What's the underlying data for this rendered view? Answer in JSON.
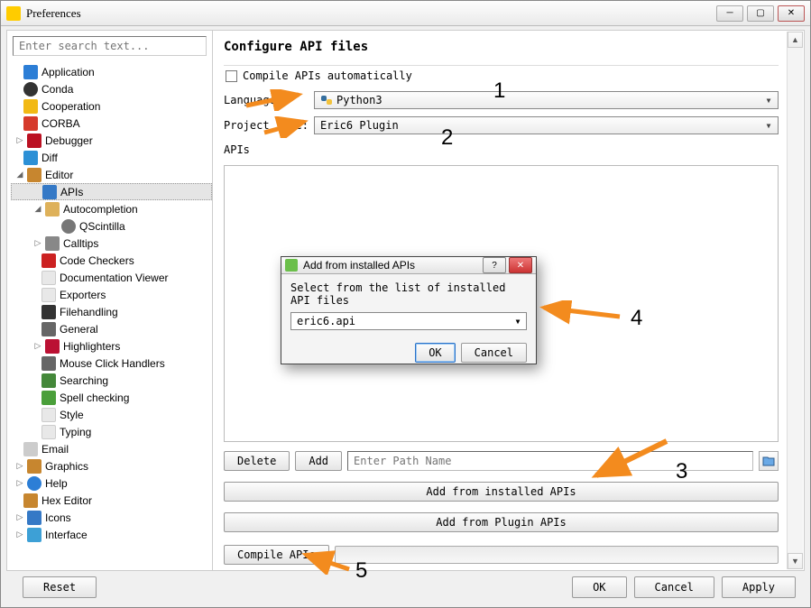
{
  "window": {
    "title": "Preferences"
  },
  "search": {
    "placeholder": "Enter search text..."
  },
  "tree": [
    {
      "label": "Application",
      "depth": 0,
      "hasChildren": false,
      "icon": "ic-app"
    },
    {
      "label": "Conda",
      "depth": 0,
      "hasChildren": false,
      "icon": "ic-conda"
    },
    {
      "label": "Cooperation",
      "depth": 0,
      "hasChildren": false,
      "icon": "ic-coop"
    },
    {
      "label": "CORBA",
      "depth": 0,
      "hasChildren": false,
      "icon": "ic-corba"
    },
    {
      "label": "Debugger",
      "depth": 0,
      "hasChildren": true,
      "expanded": false,
      "icon": "ic-debug"
    },
    {
      "label": "Diff",
      "depth": 0,
      "hasChildren": false,
      "icon": "ic-diff"
    },
    {
      "label": "Editor",
      "depth": 0,
      "hasChildren": true,
      "expanded": true,
      "icon": "ic-editor"
    },
    {
      "label": "APIs",
      "depth": 1,
      "hasChildren": false,
      "icon": "ic-apis",
      "selected": true
    },
    {
      "label": "Autocompletion",
      "depth": 1,
      "hasChildren": true,
      "expanded": true,
      "icon": "ic-auto"
    },
    {
      "label": "QScintilla",
      "depth": 2,
      "hasChildren": false,
      "icon": "ic-qs"
    },
    {
      "label": "Calltips",
      "depth": 1,
      "hasChildren": true,
      "expanded": false,
      "icon": "ic-call"
    },
    {
      "label": "Code Checkers",
      "depth": 1,
      "hasChildren": false,
      "icon": "ic-code"
    },
    {
      "label": "Documentation Viewer",
      "depth": 1,
      "hasChildren": false,
      "icon": "ic-doc"
    },
    {
      "label": "Exporters",
      "depth": 1,
      "hasChildren": false,
      "icon": "ic-exp"
    },
    {
      "label": "Filehandling",
      "depth": 1,
      "hasChildren": false,
      "icon": "ic-file"
    },
    {
      "label": "General",
      "depth": 1,
      "hasChildren": false,
      "icon": "ic-gen"
    },
    {
      "label": "Highlighters",
      "depth": 1,
      "hasChildren": true,
      "expanded": false,
      "icon": "ic-hl"
    },
    {
      "label": "Mouse Click Handlers",
      "depth": 1,
      "hasChildren": false,
      "icon": "ic-mouse"
    },
    {
      "label": "Searching",
      "depth": 1,
      "hasChildren": false,
      "icon": "ic-search"
    },
    {
      "label": "Spell checking",
      "depth": 1,
      "hasChildren": false,
      "icon": "ic-spell"
    },
    {
      "label": "Style",
      "depth": 1,
      "hasChildren": false,
      "icon": "ic-style"
    },
    {
      "label": "Typing",
      "depth": 1,
      "hasChildren": false,
      "icon": "ic-type"
    },
    {
      "label": "Email",
      "depth": 0,
      "hasChildren": false,
      "icon": "ic-email"
    },
    {
      "label": "Graphics",
      "depth": 0,
      "hasChildren": true,
      "expanded": false,
      "icon": "ic-gfx"
    },
    {
      "label": "Help",
      "depth": 0,
      "hasChildren": true,
      "expanded": false,
      "icon": "ic-help"
    },
    {
      "label": "Hex Editor",
      "depth": 0,
      "hasChildren": false,
      "icon": "ic-hex"
    },
    {
      "label": "Icons",
      "depth": 0,
      "hasChildren": true,
      "expanded": false,
      "icon": "ic-icons"
    },
    {
      "label": "Interface",
      "depth": 0,
      "hasChildren": true,
      "expanded": false,
      "icon": "ic-intf"
    }
  ],
  "page": {
    "title": "Configure API files",
    "compile_auto_label": "Compile APIs automatically",
    "language_label": "Language:",
    "language_value": "Python3",
    "project_type_label": "Project Type:",
    "project_type_value": "Eric6 Plugin",
    "apis_label": "APIs",
    "delete_btn": "Delete",
    "add_btn": "Add",
    "path_placeholder": "Enter Path Name",
    "add_installed_btn": "Add from installed APIs",
    "add_plugin_btn": "Add from Plugin APIs",
    "compile_btn": "Compile APIs"
  },
  "modal": {
    "title": "Add from installed APIs",
    "prompt": "Select from the list of installed API files",
    "selected": "eric6.api",
    "ok": "OK",
    "cancel": "Cancel"
  },
  "bottom": {
    "reset": "Reset",
    "ok": "OK",
    "cancel": "Cancel",
    "apply": "Apply"
  },
  "annotations": {
    "n1": "1",
    "n2": "2",
    "n3": "3",
    "n4": "4",
    "n5": "5"
  }
}
